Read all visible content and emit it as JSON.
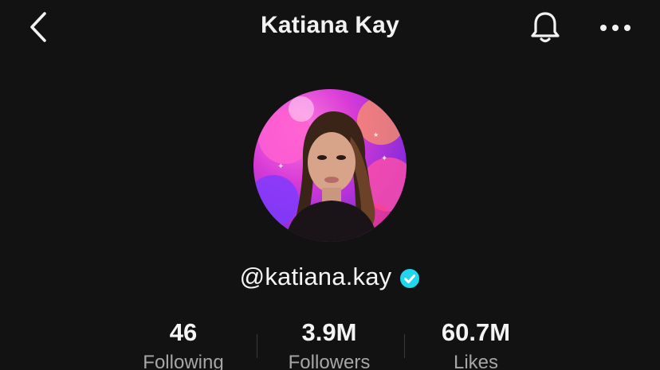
{
  "header": {
    "title": "Katiana Kay",
    "back_icon": "chevron-left-icon",
    "notification_icon": "bell-icon",
    "more_icon": "more-horizontal-icon"
  },
  "profile": {
    "avatar": "profile-photo",
    "username": "@katiana.kay",
    "verified_icon": "verified-badge-icon",
    "verified_color": "#20d5ec"
  },
  "stats": [
    {
      "value": "46",
      "label": "Following"
    },
    {
      "value": "3.9M",
      "label": "Followers"
    },
    {
      "value": "60.7M",
      "label": "Likes"
    }
  ],
  "colors": {
    "background": "#121212",
    "text_primary": "#f4f4f4",
    "text_secondary": "#a6a6a6"
  }
}
